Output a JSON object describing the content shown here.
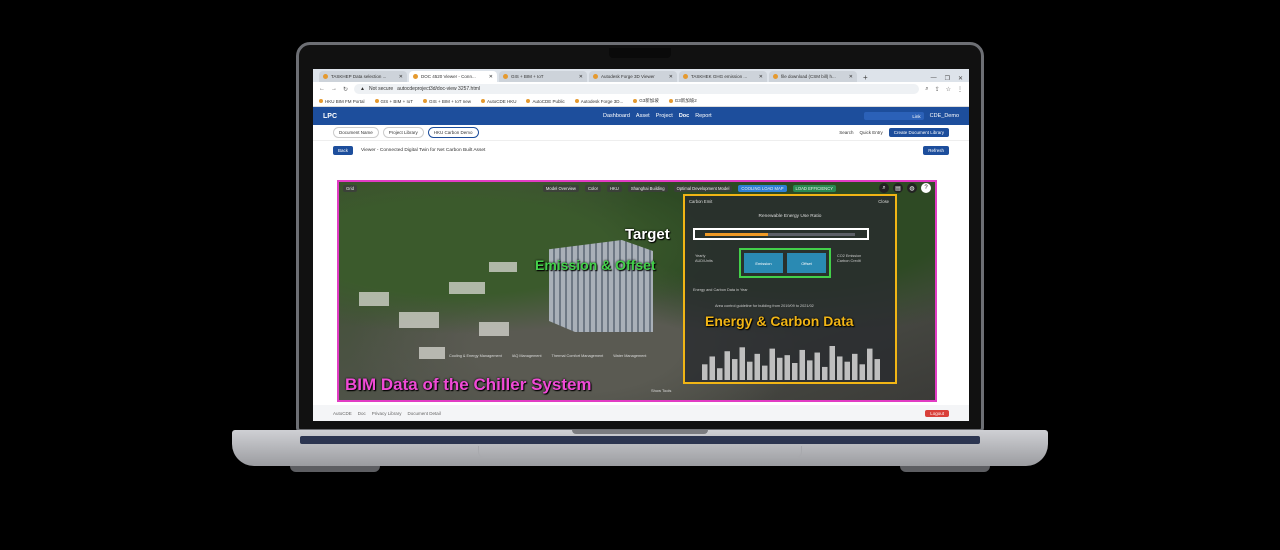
{
  "browser": {
    "tabs": [
      {
        "label": "TASKHEP Data selection ..."
      },
      {
        "label": "DOC 4520 Viewer - Conn..."
      },
      {
        "label": "GIS + BIM + IoT"
      },
      {
        "label": "Autodesk Forge 3D Viewer"
      },
      {
        "label": "TASKHEK GHG emission ..."
      },
      {
        "label": "file download (CSM bill) h..."
      }
    ],
    "new_tab": "+",
    "window_controls": [
      "—",
      "❐",
      "✕"
    ],
    "url": "autocdeproject3d/doc-view 3257.html",
    "security": "Not secure",
    "bookmarks": [
      "HKU BIM FM Portal",
      "GIS + BIM + IoT",
      "GIS + BIM + IoT new",
      "AutoCDE HKU",
      "AutoCDE Public",
      "Autodesk Forge 3D...",
      "G3新加坡",
      "G3新加坡2"
    ]
  },
  "app": {
    "logo": "LPC",
    "nav": [
      "Dashboard",
      "Asset",
      "Project",
      "Doc",
      "Report"
    ],
    "search_btn": "Link",
    "user": "CDE_Demo",
    "crumbs": [
      "Document Name",
      "Project Library",
      "HKU Carbon Demo"
    ],
    "search": "Search",
    "quick_entry": "Quick Entry",
    "create_btn": "Create Document Library",
    "back_btn": "Back",
    "viewer_title": "Viewer - Connected Digital Twin for Net Carbon Built Asset",
    "refresh_btn": "Refresh",
    "footer_links": [
      "AutoCDE",
      "Doc",
      "Privacy Library",
      "Document Detail"
    ],
    "footer_btn": "Logout"
  },
  "viewer": {
    "toolbar": [
      "Model Overview",
      "Color",
      "HKU",
      "Shanghai Building",
      "Optimal Development Model",
      "COOLING LOAD MAP",
      "LOAD EFFICIENCY"
    ],
    "icons": [
      "search-icon",
      "document-icon",
      "globe-icon",
      "help-icon"
    ],
    "panel_tab": "Carbon Emit",
    "panel_close": "Close",
    "panel_title": "Renewable Energy Use Ratio",
    "target_progress": 0.42,
    "kpis": [
      "Emission",
      "Offset"
    ],
    "side_left": "Yearly\nAUD/Units",
    "side_right": "CO2 Emission\nCarbon Credit",
    "energy_note": "Energy and Carbon Data in Year",
    "control_note": "Area control guideline for building from 2019/09 to 2021/02",
    "bottom_items": [
      "Cooling & Energy Management",
      "IAQ Management",
      "Thermal Comfort Management",
      "Water Management"
    ],
    "view_tools": "Show Tools",
    "labels": {
      "target": "Target",
      "emission": "Emission & Offset",
      "energy": "Energy & Carbon Data",
      "bim": "BIM Data of the Chiller System"
    },
    "chart_bars": [
      12,
      18,
      9,
      22,
      16,
      25,
      14,
      20,
      11,
      24,
      17,
      19,
      13,
      23,
      15,
      21,
      10,
      26,
      18,
      14,
      20,
      12,
      24,
      16
    ]
  }
}
